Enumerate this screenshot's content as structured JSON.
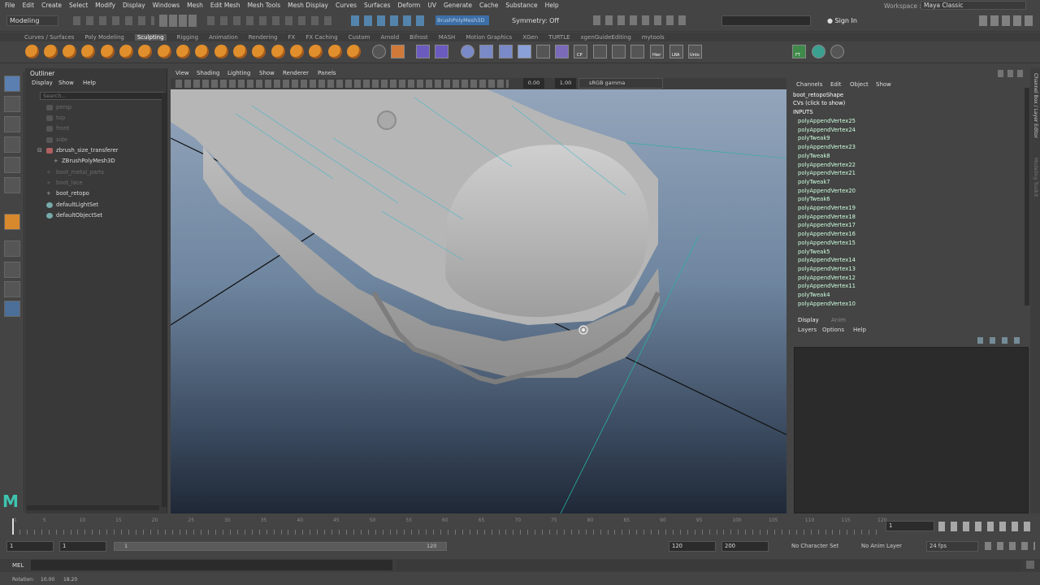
{
  "menubar": {
    "items": [
      "File",
      "Edit",
      "Create",
      "Select",
      "Modify",
      "Display",
      "Windows",
      "Mesh",
      "Edit Mesh",
      "Mesh Tools",
      "Mesh Display",
      "Curves",
      "Surfaces",
      "Deform",
      "UV",
      "Generate",
      "Cache",
      "Substance",
      "Help"
    ],
    "workspace_label": "Workspace :",
    "workspace_value": "Maya Classic"
  },
  "statusline": {
    "mode": "Modeling",
    "active_object": "BrushPolyMesh3D",
    "symmetry": "Symmetry: Off",
    "sign_in": "Sign In"
  },
  "shelf": {
    "tabs": [
      "Curves / Surfaces",
      "Poly Modeling",
      "Sculpting",
      "Rigging",
      "Animation",
      "Rendering",
      "FX",
      "FX Caching",
      "Custom",
      "Arnold",
      "Bifrost",
      "MASH",
      "Motion Graphics",
      "XGen",
      "TURTLE",
      "xgenGuideEditing",
      "mytools"
    ],
    "active_tab": "Sculpting",
    "labels": [
      "CP",
      "Hier",
      "LRA",
      "Unto",
      "FT"
    ]
  },
  "outliner": {
    "title": "Outliner",
    "menu": [
      "Display",
      "Show",
      "Help"
    ],
    "search_placeholder": "Search...",
    "items": [
      {
        "label": "persp",
        "dim": true
      },
      {
        "label": "top",
        "dim": true
      },
      {
        "label": "front",
        "dim": true
      },
      {
        "label": "side",
        "dim": true
      },
      {
        "label": "zbrush_size_transferer",
        "dim": false
      },
      {
        "label": "ZBrushPolyMesh3D",
        "dim": false
      },
      {
        "label": "boot_metal_parts",
        "dim": true
      },
      {
        "label": "boot_lace",
        "dim": true
      },
      {
        "label": "boot_retopo",
        "dim": false
      },
      {
        "label": "defaultLightSet",
        "dim": false
      },
      {
        "label": "defaultObjectSet",
        "dim": false
      }
    ]
  },
  "viewport": {
    "menu": [
      "View",
      "Shading",
      "Lighting",
      "Show",
      "Renderer",
      "Panels"
    ],
    "exposure": "0.00",
    "gamma": "1.00",
    "colorspace": "sRGB gamma"
  },
  "channelbox": {
    "menu": [
      "Channels",
      "Edit",
      "Object",
      "Show"
    ],
    "shape": "boot_retopoShape",
    "cvs": "CVs (click to show)",
    "inputs": "INPUTS",
    "nodes": [
      "polyAppendVertex25",
      "polyAppendVertex24",
      "polyTweak9",
      "polyAppendVertex23",
      "polyTweak8",
      "polyAppendVertex22",
      "polyAppendVertex21",
      "polyTweak7",
      "polyAppendVertex20",
      "polyTweak6",
      "polyAppendVertex19",
      "polyAppendVertex18",
      "polyAppendVertex17",
      "polyAppendVertex16",
      "polyAppendVertex15",
      "polyTweak5",
      "polyAppendVertex14",
      "polyAppendVertex13",
      "polyAppendVertex12",
      "polyAppendVertex11",
      "polyTweak4",
      "polyAppendVertex10"
    ]
  },
  "layereditor": {
    "tabs": [
      "Display",
      "Anim"
    ],
    "menu": [
      "Layers",
      "Options",
      "Help"
    ]
  },
  "sidetabs": [
    "Channel Box / Layer Editor",
    "Modeling Toolkit"
  ],
  "timeline": {
    "ticks": [
      "1",
      "5",
      "10",
      "15",
      "20",
      "25",
      "30",
      "35",
      "40",
      "45",
      "50",
      "55",
      "60",
      "65",
      "70",
      "75",
      "80",
      "85",
      "90",
      "95",
      "100",
      "105",
      "110",
      "115",
      "120"
    ],
    "current_frame": "1"
  },
  "range": {
    "start": "1",
    "inner_start": "1",
    "inner_end_left": "1",
    "inner_end": "120",
    "end": "120",
    "max": "200",
    "character_set": "No Character Set",
    "anim_layer": "No Anim Layer",
    "fps": "24 fps"
  },
  "cmdline": {
    "label": "MEL"
  },
  "helpline": {
    "text": "Rotation:",
    "val1": "10.00",
    "val2": "18.20"
  }
}
